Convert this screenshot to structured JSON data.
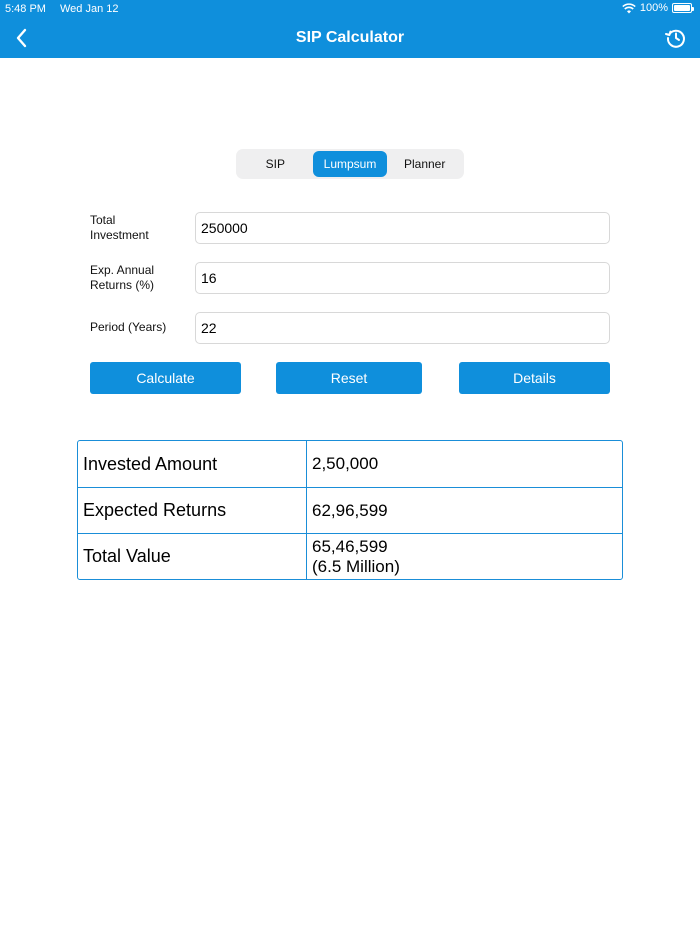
{
  "status_bar": {
    "time": "5:48 PM",
    "date": "Wed Jan 12",
    "battery": "100%"
  },
  "nav": {
    "title": "SIP Calculator",
    "back_icon": "chevron-left-icon",
    "history_icon": "history-icon"
  },
  "tabs": [
    {
      "label": "SIP",
      "active": false
    },
    {
      "label": "Lumpsum",
      "active": true
    },
    {
      "label": "Planner",
      "active": false
    }
  ],
  "form": {
    "total_investment": {
      "label_line1": "Total",
      "label_line2": "Investment",
      "value": "250000"
    },
    "annual_returns": {
      "label_line1": "Exp. Annual",
      "label_line2": "Returns (%)",
      "value": "16"
    },
    "period": {
      "label": "Period (Years)",
      "value": "22"
    }
  },
  "buttons": {
    "calculate": "Calculate",
    "reset": "Reset",
    "details": "Details"
  },
  "results": {
    "invested_amount": {
      "label": "Invested Amount",
      "value": "2,50,000"
    },
    "expected_returns": {
      "label": "Expected Returns",
      "value": "62,96,599"
    },
    "total_value": {
      "label": "Total Value",
      "value": "65,46,599",
      "value_note": "(6.5 Million)"
    }
  },
  "colors": {
    "accent": "#0f8fdc",
    "border": "#1a8ed8"
  }
}
